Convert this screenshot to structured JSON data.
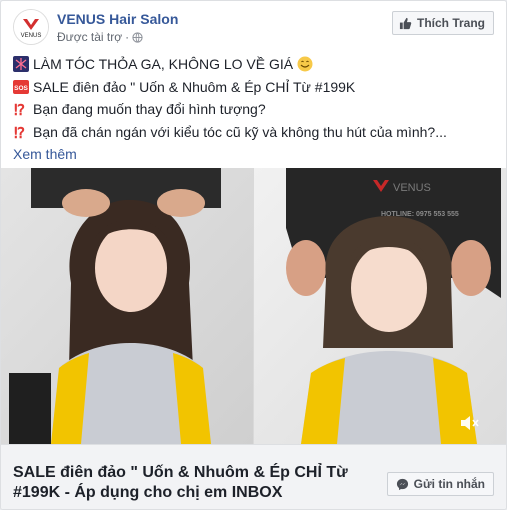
{
  "page": {
    "name": "VENUS Hair Salon",
    "sponsored": "Được tài trợ",
    "separator": "·",
    "avatar_text": "VENUS",
    "like_button": "Thích Trang"
  },
  "post": {
    "line1": "LÀM TÓC THỎA GA, KHÔNG LO VỀ GIÁ",
    "line2": "SALE điên đảo \" Uốn & Nhuôm & Ép CHỈ Từ #199K",
    "line3": "Bạn đang muốn thay đổi hình tượng?",
    "line4": "Bạn đã chán ngán với kiểu tóc cũ kỹ và không thu hút của mình?...",
    "see_more": "Xem thêm",
    "sos_badge": "SOS"
  },
  "media": {
    "watermark_brand": "VENUS",
    "watermark_hotline": "HOTLINE: 0975 553 555"
  },
  "link": {
    "title": "SALE điên đảo \" Uốn & Nhuôm & Ép CHỈ Từ #199K - Áp dụng cho chị em INBOX",
    "message_button": "Gửi tin nhắn"
  },
  "colors": {
    "link_blue": "#365899",
    "text": "#1d2129",
    "shirt_yellow": "#f2c400",
    "shirt_gray": "#c9ccd3"
  }
}
